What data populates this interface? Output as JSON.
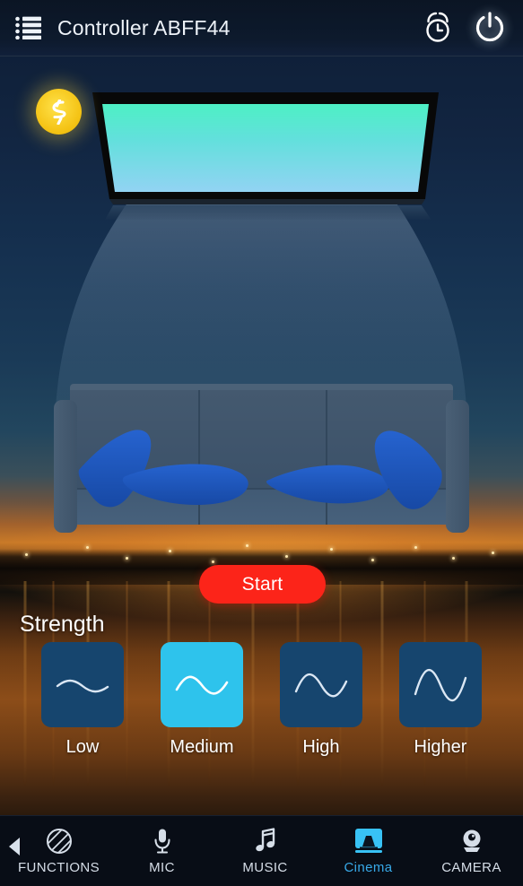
{
  "header": {
    "title": "Controller ABFF44",
    "menu_icon": "list-icon",
    "alarm_icon": "alarm-clock-icon",
    "power_icon": "power-icon"
  },
  "scene": {
    "badge_icon": "lightning-bolt-icon",
    "tv_screen_color_top": "#57f0c8",
    "tv_screen_color_bottom": "#8fd2f2",
    "tv_bezel_color": "#080808",
    "sofa_color": "#3c5470",
    "cushion_color": "#1d56b8",
    "background": "sunset-over-water-photo"
  },
  "main": {
    "start_label": "Start",
    "start_color": "#fc2419",
    "strength_label": "Strength",
    "selected_strength": "Medium",
    "strength_options": [
      {
        "label": "Low",
        "amplitude": 8,
        "selected": false,
        "icon": "wave-low-icon"
      },
      {
        "label": "Medium",
        "amplitude": 15,
        "selected": true,
        "icon": "wave-medium-icon"
      },
      {
        "label": "High",
        "amplitude": 20,
        "selected": false,
        "icon": "wave-high-icon"
      },
      {
        "label": "Higher",
        "amplitude": 27,
        "selected": false,
        "icon": "wave-higher-icon"
      }
    ],
    "tile_color": "#16456e",
    "tile_active_color": "#2ec3ec"
  },
  "bottom_nav": {
    "back_icon": "back-arrow-icon",
    "active": "Cinema",
    "accent_color": "#38a9e8",
    "items": [
      {
        "label": "FUNCTIONS",
        "icon": "striped-circle-icon",
        "active": false
      },
      {
        "label": "MIC",
        "icon": "microphone-icon",
        "active": false
      },
      {
        "label": "MUSIC",
        "icon": "music-note-icon",
        "active": false
      },
      {
        "label": "Cinema",
        "icon": "cinema-screen-icon",
        "active": true
      },
      {
        "label": "CAMERA",
        "icon": "webcam-icon",
        "active": false
      }
    ]
  }
}
